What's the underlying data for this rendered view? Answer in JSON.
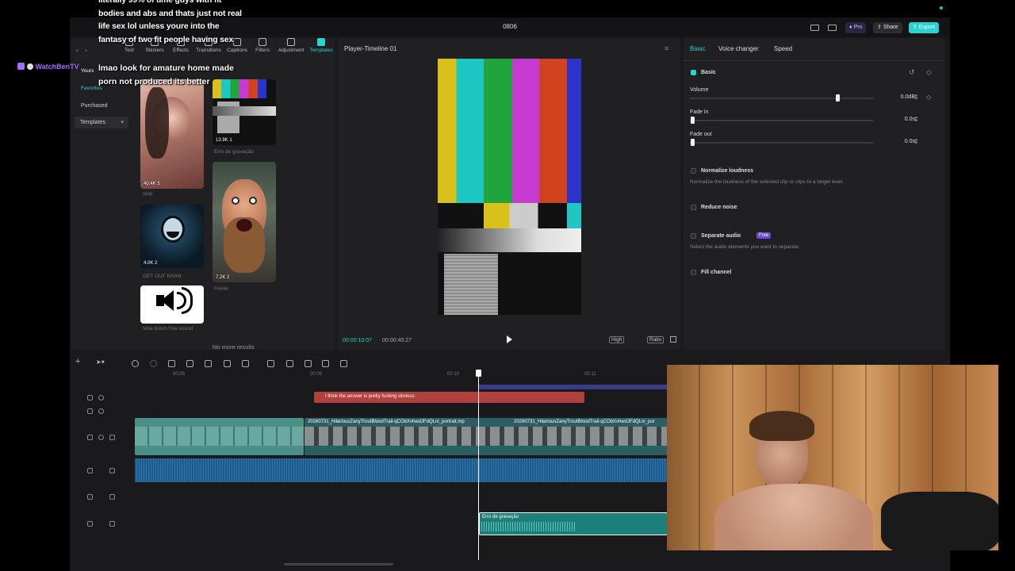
{
  "stream": {
    "chat_user": "WatchBenTV",
    "chat_message_top": "literally 99% of time guys with fit bodies and abs and thats just not real life sex lol unless youre into the fantasy of two fit people having sex",
    "chat_message_bottom": "lmao look for amature home made porn not produced its better"
  },
  "window": {
    "title": "0806",
    "pro_label": "Pro",
    "share_label": "Share",
    "export_label": "Export"
  },
  "toolbar": {
    "items": [
      "Text",
      "Stickers",
      "Effects",
      "Transitions",
      "Captions",
      "Filters",
      "Adjustment",
      "Templates"
    ]
  },
  "sidebar": {
    "yours": "Yours",
    "favorites": "Favorites",
    "purchased": "Purchased",
    "templates": "Templates"
  },
  "library": {
    "items": [
      {
        "stats": "40.4K  5",
        "label": "stop"
      },
      {
        "stats": "13.9K  1",
        "label": "Erro de gravação"
      },
      {
        "stats": "4.0K  2",
        "label": "GET OUT KHAN"
      },
      {
        "stats": "7.2K  2",
        "label": "FAHH"
      },
      {
        "stats": "",
        "label": "Vine boom free sound"
      }
    ],
    "no_more": "No more results"
  },
  "player": {
    "title": "Player-Timeline 01",
    "current_time": "00:00:10:07",
    "total_time": "00:00:40:27",
    "quality": "High",
    "ratio": "Ratio"
  },
  "inspector": {
    "tabs": [
      "Basic",
      "Voice changer",
      "Speed"
    ],
    "section": "Basic",
    "volume_label": "Volume",
    "volume_value": "0.0dB",
    "volume_level": 0.8,
    "fade_in_label": "Fade in",
    "fade_in_value": "0.0s",
    "fade_out_label": "Fade out",
    "fade_out_value": "0.0s",
    "normalize_label": "Normalize loudness",
    "normalize_desc": "Normalize the loudness of the selected clip or clips to a target level.",
    "reduce_noise_label": "Reduce noise",
    "separate_audio_label": "Separate audio",
    "separate_badge": "Free",
    "separate_desc": "Select the audio elements you want to separate.",
    "fill_channel_label": "Fill channel"
  },
  "timeline": {
    "ruler": [
      "00:08",
      "00:09",
      "00:10",
      "00:11"
    ],
    "text_clip": "I think the answer is pretty fucking obvious",
    "video_clip_a": "20260731_HilariousZanyTroutBloodTrail-qCObXvhwdJFdQLni_portrait.mp",
    "video_clip_b": "20260731_HilariousZanyTroutBloodTrail-qCObXvhwdJFdQLni_por",
    "audio_clip": "Erro de gravação"
  },
  "colors": {
    "accent": "#2bd3d0",
    "text_clip": "#b0413e",
    "audio_track": "#1d5a8a",
    "audio_clip": "#1d7f7a"
  }
}
